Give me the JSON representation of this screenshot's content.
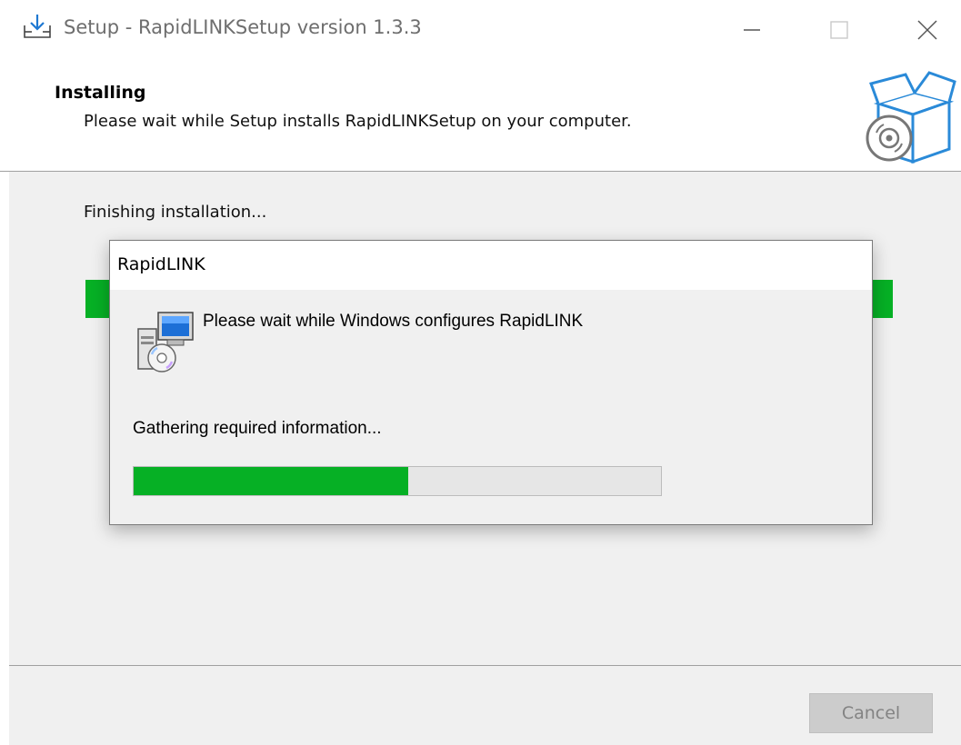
{
  "window": {
    "title": "Setup - RapidLINKSetup version 1.3.3",
    "icon": "download-tray-icon"
  },
  "header": {
    "title": "Installing",
    "subtitle": "Please wait while Setup installs RapidLINKSetup on your computer.",
    "icon": "software-box-icon"
  },
  "main": {
    "status": "Finishing installation...",
    "progress": 1.0
  },
  "footer": {
    "cancel_label": "Cancel"
  },
  "dialog": {
    "title": "RapidLINK",
    "message": "Please wait while Windows configures RapidLINK",
    "status": "Gathering required information...",
    "progress": 0.52,
    "icon": "windows-installer-icon"
  },
  "colors": {
    "progress_fill": "#06b025",
    "progress_track": "#e6e6e6",
    "panel_bg": "#f0f0f0"
  }
}
